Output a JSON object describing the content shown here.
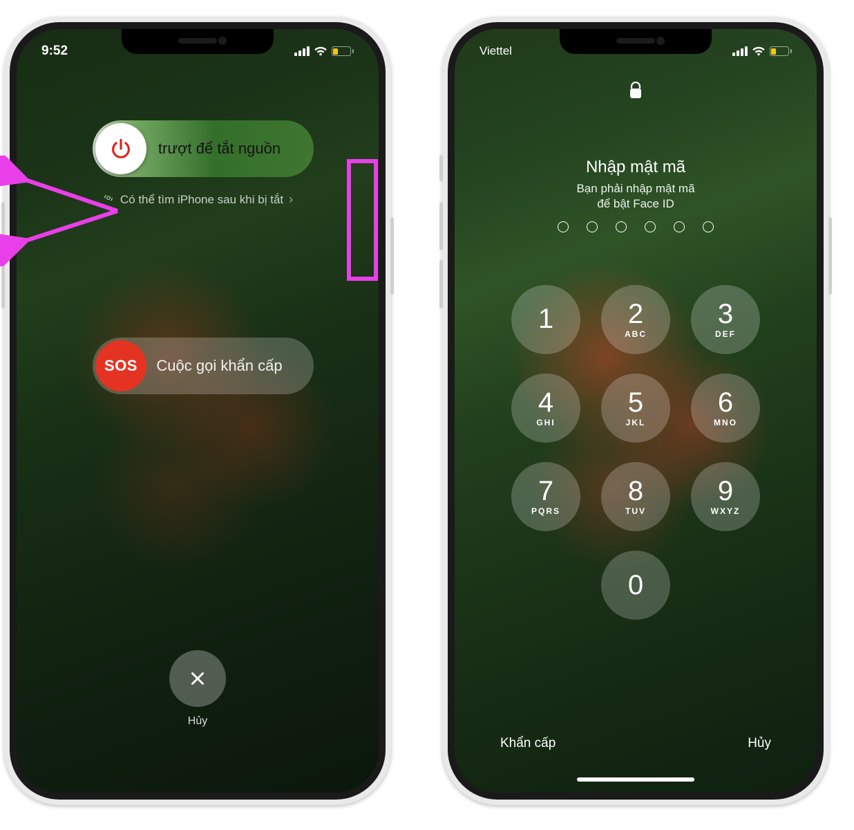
{
  "left": {
    "status": {
      "time": "9:52"
    },
    "power_slider": {
      "label": "trượt để tắt nguồn"
    },
    "find_iphone": {
      "label": "Có thể tìm iPhone sau khi bị tắt"
    },
    "sos": {
      "badge": "SOS",
      "label": "Cuộc gọi khẩn cấp"
    },
    "cancel": {
      "label": "Hủy"
    }
  },
  "right": {
    "status": {
      "carrier": "Viettel"
    },
    "lock": {
      "title": "Nhập mật mã",
      "subtitle_l1": "Bạn phải nhập mật mã",
      "subtitle_l2": "để bật Face ID"
    },
    "keypad": [
      {
        "num": "1",
        "let": ""
      },
      {
        "num": "2",
        "let": "ABC"
      },
      {
        "num": "3",
        "let": "DEF"
      },
      {
        "num": "4",
        "let": "GHI"
      },
      {
        "num": "5",
        "let": "JKL"
      },
      {
        "num": "6",
        "let": "MNO"
      },
      {
        "num": "7",
        "let": "PQRS"
      },
      {
        "num": "8",
        "let": "TUV"
      },
      {
        "num": "9",
        "let": "WXYZ"
      },
      {
        "num": "0",
        "let": ""
      }
    ],
    "bottom": {
      "emergency": "Khẩn cấp",
      "cancel": "Hủy"
    }
  },
  "annotations": {
    "highlight_color": "#e83fe8"
  }
}
